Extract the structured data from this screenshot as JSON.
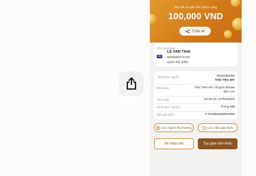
{
  "share_icon": "share-up-arrow-icon",
  "header": {
    "subtitle": "Bạn đã chuyển tiền thành công",
    "amount": "100,000 VND",
    "share_label": "Chia sẻ",
    "share_icon": "share-nodes-icon"
  },
  "recipient": {
    "label": "Đến tài khoản",
    "name": "LE VAN THAI",
    "account": "0000986371792",
    "bank": "Quân Đội (MB)",
    "bank_logo": "MB"
  },
  "details": {
    "source_label": "Tài khoản nguồn",
    "source_number": "0945485492",
    "source_name": "TAN TRA MY",
    "content_label": "Nội dung",
    "content_value": "TAN TRA MY chuyen khoan tien coc",
    "time_label": "Thời gian",
    "time_value": "13:30:22, 27/02/2022",
    "method_label": "Hình thức chuyển",
    "method_value": "Trong MB",
    "txid_label": "Mã giao dịch",
    "txid_value": "FT22059496603093"
  },
  "actions": {
    "save_recipient": "Lưu người thụ hưởng",
    "save_template": "Lưu mẫu giao dịch",
    "home": "Về trang chủ",
    "new_transaction": "Tạo giao dịch khác"
  }
}
